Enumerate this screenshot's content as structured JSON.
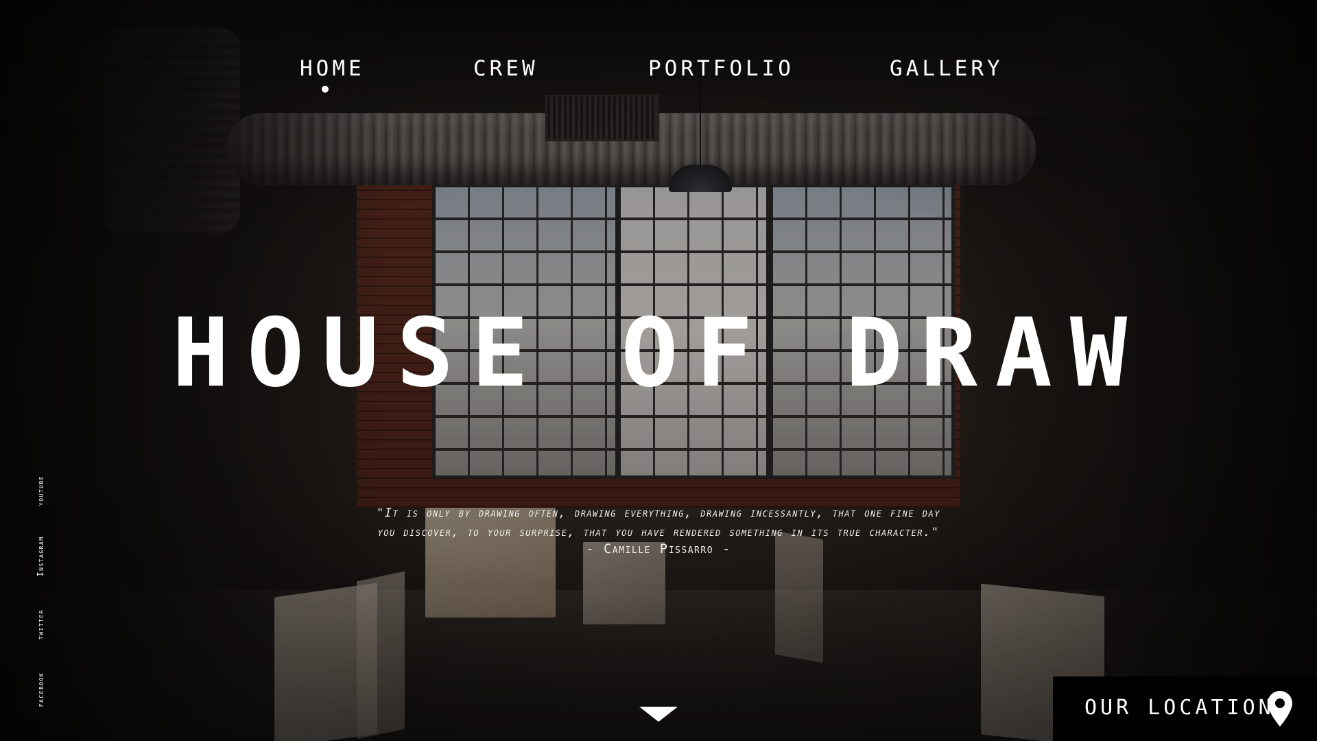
{
  "nav": {
    "items": [
      {
        "label": "HOME",
        "active": true
      },
      {
        "label": "CREW",
        "active": false
      },
      {
        "label": "PORTFOLIO",
        "active": false
      },
      {
        "label": "GALLERY",
        "active": false
      }
    ]
  },
  "hero": {
    "title": "HOUSE OF DRAW",
    "quote_line1": "\"It is only by drawing often, drawing everything, drawing incessantly, that one fine day",
    "quote_line2": "you discover, to your surprise, that you have rendered something in its true character.\"",
    "quote_author": "- Camille Pissarro -"
  },
  "social": {
    "links": [
      {
        "label": "youtube",
        "icon": "youtube"
      },
      {
        "label": "Instagram",
        "icon": "instagram"
      },
      {
        "label": "twitter",
        "icon": "twitter"
      },
      {
        "label": "facebook",
        "icon": "facebook"
      }
    ]
  },
  "location": {
    "label": "OUR LOCATION",
    "icon": "map-pin-icon"
  },
  "scroll": {
    "icon": "caret-down-icon"
  },
  "colors": {
    "text": "#ffffff",
    "location_box": "#000000"
  }
}
